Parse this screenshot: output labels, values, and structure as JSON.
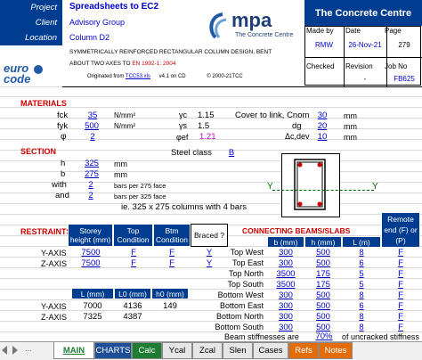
{
  "header": {
    "project_label": "Project",
    "project_value": "Spreadsheets to  EC2",
    "client_label": "Client",
    "client_value": "Advisory Group",
    "location_label": "Location",
    "location_value": "Column D2",
    "description_1": "SYMMETRICALLY  REINFORCED  RECTANGULAR  COLUMN  DESIGN,  BENT",
    "description_2_a": "ABOUT TWO AXES TO ",
    "description_2_b": "EN 1992-1: 2004",
    "originated_label": "Originated from ",
    "originated_file": "TCC53.xls",
    "version": "v4.1 on CD",
    "copyright": "© 2000-21TCC",
    "logo_left_line1": "euro",
    "logo_left_line2": "code",
    "logo_mpa": "mpa",
    "logo_mpa_sub": "The Concrete Centre",
    "org_title": "The Concrete Centre",
    "made_by_label": "Made by",
    "made_by_value": "RMW",
    "date_label": "Date",
    "date_value": "26-Nov-21",
    "page_label": "Page",
    "page_value": "279",
    "checked_label": "Checked",
    "revision_label": "Revision",
    "revision_value": "-",
    "job_label": "Job No",
    "job_value": "FB625"
  },
  "materials": {
    "title": "MATERIALS",
    "fck_label": "fck",
    "fck_value": "35",
    "fck_unit": "N/mm²",
    "gamma_c_label": "γc",
    "gamma_c_value": "1.15",
    "fyk_label": "fyk",
    "fyk_value": "500",
    "fyk_unit": "N/mm²",
    "gamma_s_label": "γs",
    "gamma_s_value": "1.5",
    "phi_label": "φ",
    "phi_value": "2",
    "phi_ef_label": "φef",
    "phi_ef_value": "1.21",
    "cover_label": "Cover to link, Cnom",
    "cover_value": "30",
    "cover_unit": "mm",
    "dg_label": "dg",
    "dg_value": "20",
    "dg_unit": "mm",
    "dcdev_label": "Δc,dev",
    "dcdev_value": "10",
    "dcdev_unit": "mm"
  },
  "section": {
    "title": "SECTION",
    "h_label": "h",
    "h_value": "325",
    "h_unit": "mm",
    "b_label": "b",
    "b_value": "275",
    "b_unit": "mm",
    "with_label": "with",
    "with_value": "2",
    "with_text": "bars per 275 face",
    "and_label": "and",
    "and_value": "2",
    "and_text": "bars per 325 face",
    "summary": "ie.  325 x 275 columns with 4 bars",
    "steel_class_label": "Steel class",
    "steel_class_value": "B",
    "y_left": "Y",
    "y_right": "Y"
  },
  "restraints": {
    "title": "RESTRAINTS",
    "headers": [
      "Storey height (mm)",
      "Top Condition",
      "Btm Condition",
      "Braced ?"
    ],
    "rows": [
      {
        "axis": "Y-AXIS",
        "height": "7500",
        "top": "F",
        "btm": "F",
        "braced": "Y"
      },
      {
        "axis": "Z-AXIS",
        "height": "7500",
        "top": "F",
        "btm": "F",
        "braced": "Y"
      }
    ],
    "l_headers": [
      "L (mm)",
      "L0 (mm)",
      "h0 (mm)"
    ],
    "l_rows": [
      {
        "axis": "Y-AXIS",
        "l": "7000",
        "l0": "4136",
        "h0": "149"
      },
      {
        "axis": "Z-AXIS",
        "l": "7325",
        "l0": "4387",
        "h0": ""
      }
    ]
  },
  "beams": {
    "title": "CONNECTING BEAMS/SLABS",
    "headers": [
      "b (mm)",
      "h (mm)",
      "L (m)"
    ],
    "remote_header": "Remote end (F) or (P)",
    "rows": [
      {
        "label": "Top West",
        "b": "300",
        "h": "500",
        "l": "8",
        "remote": "F"
      },
      {
        "label": "Top East",
        "b": "300",
        "h": "500",
        "l": "6",
        "remote": "F"
      },
      {
        "label": "Top North",
        "b": "3500",
        "h": "175",
        "l": "5",
        "remote": "F"
      },
      {
        "label": "Top South",
        "b": "3500",
        "h": "175",
        "l": "5",
        "remote": "F"
      },
      {
        "label": "Bottom West",
        "b": "300",
        "h": "500",
        "l": "8",
        "remote": "F"
      },
      {
        "label": "Bottom East",
        "b": "300",
        "h": "500",
        "l": "6",
        "remote": "F"
      },
      {
        "label": "Bottom North",
        "b": "300",
        "h": "500",
        "l": "8",
        "remote": "F"
      },
      {
        "label": "Bottom South",
        "b": "300",
        "h": "500",
        "l": "8",
        "remote": "F"
      }
    ],
    "stiffness_label": "Beam stiffnesses are",
    "stiffness_value": "70%",
    "stiffness_text": "of uncracked stiffness"
  },
  "tabs": [
    {
      "label": "MAIN",
      "bg": "#ffffff",
      "fg": "#000000",
      "active": true
    },
    {
      "label": "CHARTS",
      "bg": "#1f4e99",
      "fg": "#ffffff"
    },
    {
      "label": "Calc",
      "bg": "#1e7d32",
      "fg": "#ffffff"
    },
    {
      "label": "Ycal",
      "bg": "#e6e6e6",
      "fg": "#000000"
    },
    {
      "label": "Zcal",
      "bg": "#e6e6e6",
      "fg": "#000000"
    },
    {
      "label": "Slen",
      "bg": "#e6e6e6",
      "fg": "#000000"
    },
    {
      "label": "Cases",
      "bg": "#e6e6e6",
      "fg": "#000000"
    },
    {
      "label": "Refs",
      "bg": "#e36c09",
      "fg": "#ffffff"
    },
    {
      "label": "Notes",
      "bg": "#e36c09",
      "fg": "#ffffff"
    }
  ]
}
